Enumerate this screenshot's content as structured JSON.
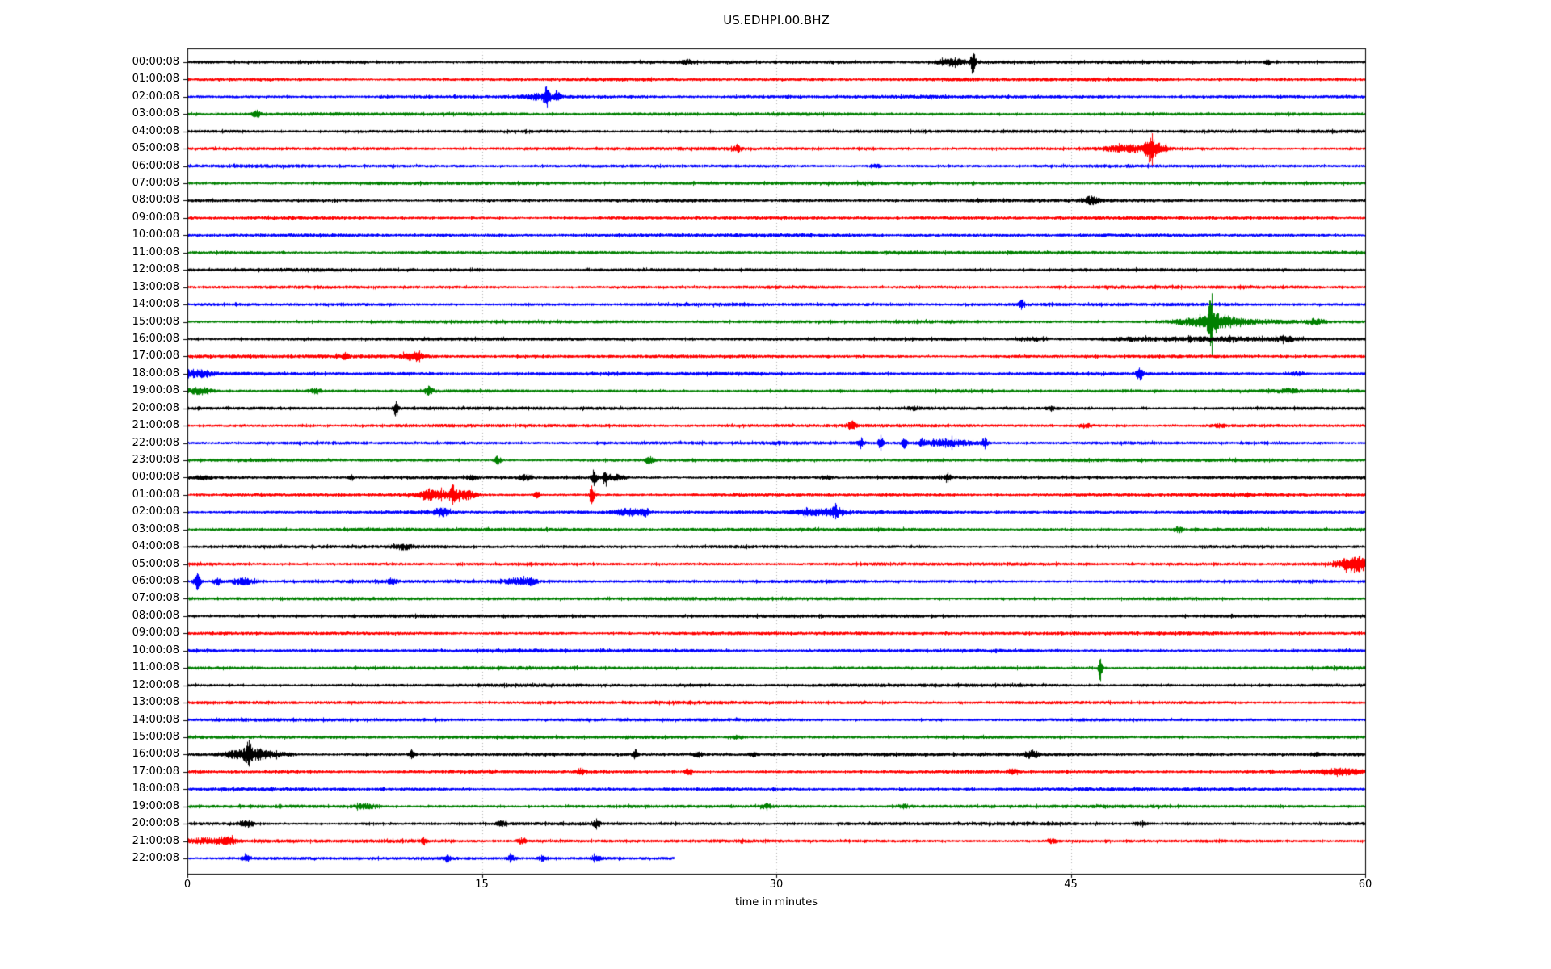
{
  "title": "US.EDHPI.00.BHZ",
  "chart_data": {
    "type": "line",
    "subtype": "seismogram-dayplot",
    "title": "US.EDHPI.00.BHZ",
    "xlabel": "time in minutes",
    "x_range": [
      0,
      60
    ],
    "x_ticks": [
      0,
      15,
      30,
      45,
      60
    ],
    "grid_minutes": [
      15,
      30,
      45
    ],
    "grid_on": true,
    "grid_color": "#b0b0b0",
    "axis_color": "#000000",
    "background_color": "#ffffff",
    "color_cycle": [
      "#000000",
      "#ff0000",
      "#0000ff",
      "#008000"
    ],
    "events_format": "each event = [minute, half_width_minutes, extra_half_amplitude_px]",
    "rows": [
      {
        "label": "00:00:08",
        "duration_min": 60,
        "events": [
          [
            25.5,
            0.2,
            2
          ],
          [
            38.9,
            0.5,
            4
          ],
          [
            40.0,
            0.08,
            14
          ],
          [
            55.0,
            0.1,
            3
          ]
        ]
      },
      {
        "label": "01:00:08",
        "duration_min": 60,
        "events": []
      },
      {
        "label": "02:00:08",
        "duration_min": 60,
        "events": [
          [
            17.8,
            0.5,
            3
          ],
          [
            18.3,
            0.08,
            12
          ],
          [
            18.8,
            0.12,
            6
          ]
        ]
      },
      {
        "label": "03:00:08",
        "duration_min": 60,
        "events": [
          [
            3.5,
            0.15,
            4
          ]
        ]
      },
      {
        "label": "04:00:08",
        "duration_min": 60,
        "events": []
      },
      {
        "label": "05:00:08",
        "duration_min": 60,
        "events": [
          [
            28.0,
            0.15,
            4
          ],
          [
            47.8,
            0.8,
            4
          ],
          [
            49.0,
            0.15,
            12
          ],
          [
            49.4,
            0.3,
            6
          ]
        ]
      },
      {
        "label": "06:00:08",
        "duration_min": 60,
        "events": [
          [
            35.0,
            0.2,
            2
          ]
        ]
      },
      {
        "label": "07:00:08",
        "duration_min": 60,
        "events": []
      },
      {
        "label": "08:00:08",
        "duration_min": 60,
        "events": [
          [
            46.0,
            0.3,
            4
          ]
        ]
      },
      {
        "label": "09:00:08",
        "duration_min": 60,
        "events": []
      },
      {
        "label": "10:00:08",
        "duration_min": 60,
        "events": []
      },
      {
        "label": "11:00:08",
        "duration_min": 60,
        "events": []
      },
      {
        "label": "12:00:08",
        "duration_min": 60,
        "events": []
      },
      {
        "label": "13:00:08",
        "duration_min": 60,
        "events": []
      },
      {
        "label": "14:00:08",
        "duration_min": 60,
        "events": [
          [
            42.5,
            0.1,
            5
          ]
        ]
      },
      {
        "label": "15:00:08",
        "duration_min": 60,
        "events": [
          [
            51.5,
            1.0,
            4
          ],
          [
            52.1,
            0.08,
            30
          ],
          [
            52.6,
            0.5,
            6
          ],
          [
            54.0,
            1.5,
            2
          ],
          [
            57.5,
            0.3,
            3
          ]
        ]
      },
      {
        "label": "16:00:08",
        "duration_min": 60,
        "events": [
          [
            43.0,
            0.5,
            2
          ],
          [
            48.0,
            1.0,
            1.5
          ],
          [
            52.0,
            2.0,
            2
          ],
          [
            56.0,
            0.5,
            2
          ]
        ]
      },
      {
        "label": "17:00:08",
        "duration_min": 60,
        "events": [
          [
            8.0,
            0.2,
            2
          ],
          [
            11.5,
            0.4,
            4
          ]
        ]
      },
      {
        "label": "18:00:08",
        "duration_min": 60,
        "events": [
          [
            0.5,
            0.5,
            4
          ],
          [
            48.5,
            0.12,
            7
          ],
          [
            56.5,
            0.3,
            2
          ]
        ]
      },
      {
        "label": "19:00:08",
        "duration_min": 60,
        "events": [
          [
            0.6,
            0.4,
            4
          ],
          [
            6.5,
            0.2,
            3
          ],
          [
            12.3,
            0.15,
            5
          ],
          [
            56.0,
            0.3,
            2
          ]
        ]
      },
      {
        "label": "20:00:08",
        "duration_min": 60,
        "events": [
          [
            10.6,
            0.08,
            9
          ],
          [
            37.0,
            0.2,
            1.5
          ],
          [
            44.0,
            0.2,
            1.5
          ]
        ]
      },
      {
        "label": "21:00:08",
        "duration_min": 60,
        "events": [
          [
            33.8,
            0.15,
            5
          ],
          [
            45.8,
            0.2,
            2
          ],
          [
            52.5,
            0.3,
            1.5
          ]
        ]
      },
      {
        "label": "22:00:08",
        "duration_min": 60,
        "events": [
          [
            34.3,
            0.1,
            6
          ],
          [
            35.3,
            0.08,
            9
          ],
          [
            36.5,
            0.1,
            6
          ],
          [
            37.4,
            0.1,
            4
          ],
          [
            38.8,
            0.8,
            4
          ],
          [
            40.6,
            0.1,
            6
          ]
        ]
      },
      {
        "label": "23:00:08",
        "duration_min": 60,
        "events": [
          [
            15.8,
            0.12,
            5
          ],
          [
            23.5,
            0.15,
            4
          ]
        ]
      },
      {
        "label": "00:00:08",
        "duration_min": 60,
        "events": [
          [
            0.8,
            0.3,
            2
          ],
          [
            8.3,
            0.1,
            3
          ],
          [
            14.5,
            0.2,
            2
          ],
          [
            17.2,
            0.2,
            3
          ],
          [
            20.7,
            0.1,
            9
          ],
          [
            21.3,
            0.15,
            5
          ],
          [
            21.9,
            0.3,
            3
          ],
          [
            32.5,
            0.2,
            2
          ],
          [
            38.7,
            0.12,
            5
          ]
        ]
      },
      {
        "label": "01:00:08",
        "duration_min": 60,
        "events": [
          [
            12.2,
            0.15,
            6
          ],
          [
            13.0,
            0.8,
            4
          ],
          [
            13.5,
            0.1,
            8
          ],
          [
            14.2,
            0.3,
            4
          ],
          [
            17.8,
            0.1,
            4
          ],
          [
            20.6,
            0.08,
            11
          ]
        ]
      },
      {
        "label": "02:00:08",
        "duration_min": 60,
        "events": [
          [
            12.9,
            0.25,
            5
          ],
          [
            22.5,
            0.5,
            4
          ],
          [
            23.3,
            0.15,
            4
          ],
          [
            31.8,
            0.6,
            3
          ],
          [
            33.0,
            0.3,
            5
          ]
        ]
      },
      {
        "label": "03:00:08",
        "duration_min": 60,
        "events": [
          [
            50.5,
            0.12,
            4
          ]
        ]
      },
      {
        "label": "04:00:08",
        "duration_min": 60,
        "events": [
          [
            11.0,
            0.3,
            2.5
          ]
        ]
      },
      {
        "label": "05:00:08",
        "duration_min": 60,
        "events": [
          [
            59.2,
            0.5,
            6
          ],
          [
            59.8,
            0.2,
            6
          ]
        ]
      },
      {
        "label": "06:00:08",
        "duration_min": 60,
        "events": [
          [
            0.5,
            0.12,
            10
          ],
          [
            1.5,
            0.15,
            4
          ],
          [
            2.8,
            0.4,
            4
          ],
          [
            10.4,
            0.15,
            3
          ],
          [
            16.8,
            0.5,
            3
          ],
          [
            17.5,
            0.2,
            3
          ]
        ]
      },
      {
        "label": "07:00:08",
        "duration_min": 60,
        "events": []
      },
      {
        "label": "08:00:08",
        "duration_min": 60,
        "events": []
      },
      {
        "label": "09:00:08",
        "duration_min": 60,
        "events": []
      },
      {
        "label": "10:00:08",
        "duration_min": 60,
        "events": []
      },
      {
        "label": "11:00:08",
        "duration_min": 60,
        "events": [
          [
            46.5,
            0.07,
            16
          ]
        ]
      },
      {
        "label": "12:00:08",
        "duration_min": 60,
        "events": []
      },
      {
        "label": "13:00:08",
        "duration_min": 60,
        "events": []
      },
      {
        "label": "14:00:08",
        "duration_min": 60,
        "events": []
      },
      {
        "label": "15:00:08",
        "duration_min": 60,
        "events": [
          [
            28.0,
            0.2,
            2
          ]
        ]
      },
      {
        "label": "16:00:08",
        "duration_min": 60,
        "events": [
          [
            2.6,
            0.5,
            5
          ],
          [
            3.1,
            0.12,
            13
          ],
          [
            3.6,
            0.3,
            5
          ],
          [
            4.5,
            0.6,
            2.5
          ],
          [
            11.4,
            0.1,
            5
          ],
          [
            22.8,
            0.1,
            5
          ],
          [
            26.0,
            0.15,
            3
          ],
          [
            28.8,
            0.12,
            2.5
          ],
          [
            43.0,
            0.25,
            4
          ],
          [
            57.5,
            0.2,
            2
          ]
        ]
      },
      {
        "label": "17:00:08",
        "duration_min": 60,
        "events": [
          [
            20.0,
            0.12,
            4
          ],
          [
            25.5,
            0.15,
            3
          ],
          [
            42.0,
            0.15,
            4
          ],
          [
            58.8,
            0.8,
            3
          ]
        ]
      },
      {
        "label": "18:00:08",
        "duration_min": 60,
        "events": []
      },
      {
        "label": "19:00:08",
        "duration_min": 60,
        "events": [
          [
            9.0,
            0.4,
            3
          ],
          [
            29.5,
            0.2,
            2.5
          ],
          [
            36.5,
            0.25,
            2
          ]
        ]
      },
      {
        "label": "20:00:08",
        "duration_min": 60,
        "events": [
          [
            3.0,
            0.25,
            4
          ],
          [
            16.0,
            0.15,
            3
          ],
          [
            20.8,
            0.15,
            4
          ],
          [
            48.5,
            0.2,
            2
          ]
        ]
      },
      {
        "label": "21:00:08",
        "duration_min": 60,
        "events": [
          [
            0.8,
            0.7,
            3
          ],
          [
            2.0,
            0.3,
            4
          ],
          [
            12.0,
            0.1,
            4
          ],
          [
            17.0,
            0.15,
            3
          ],
          [
            44.0,
            0.2,
            2
          ]
        ]
      },
      {
        "label": "22:00:08",
        "duration_min": 24.8,
        "events": [
          [
            3.0,
            0.15,
            3
          ],
          [
            13.2,
            0.1,
            5
          ],
          [
            16.5,
            0.15,
            3
          ],
          [
            18.1,
            0.15,
            3
          ],
          [
            20.8,
            0.2,
            3
          ]
        ]
      }
    ]
  }
}
